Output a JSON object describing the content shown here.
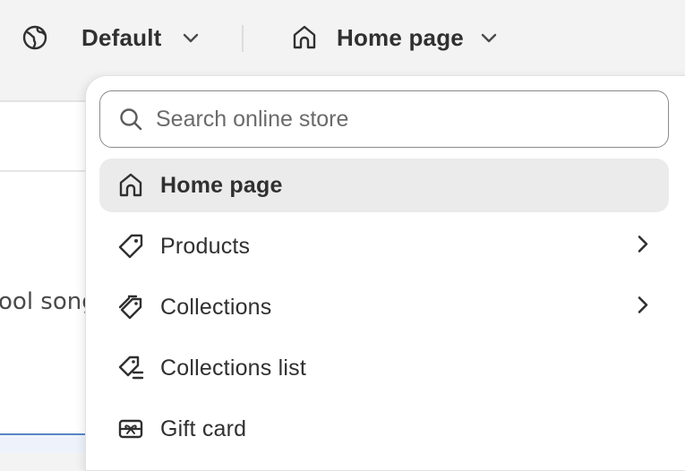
{
  "topbar": {
    "market_label": "Default",
    "page_label": "Home page"
  },
  "background": {
    "snippet_text": "ool song"
  },
  "search": {
    "placeholder": "Search online store",
    "value": ""
  },
  "menu": {
    "items": [
      {
        "label": "Home page",
        "icon": "home-icon",
        "selected": true,
        "has_submenu": false
      },
      {
        "label": "Products",
        "icon": "tag-icon",
        "selected": false,
        "has_submenu": true
      },
      {
        "label": "Collections",
        "icon": "tags-icon",
        "selected": false,
        "has_submenu": true
      },
      {
        "label": "Collections list",
        "icon": "tag-list-icon",
        "selected": false,
        "has_submenu": false
      },
      {
        "label": "Gift card",
        "icon": "gift-card-icon",
        "selected": false,
        "has_submenu": false
      }
    ]
  },
  "colors": {
    "selected_bg": "#ebebeb",
    "text": "#303030",
    "accent_border": "#5a86c7"
  }
}
